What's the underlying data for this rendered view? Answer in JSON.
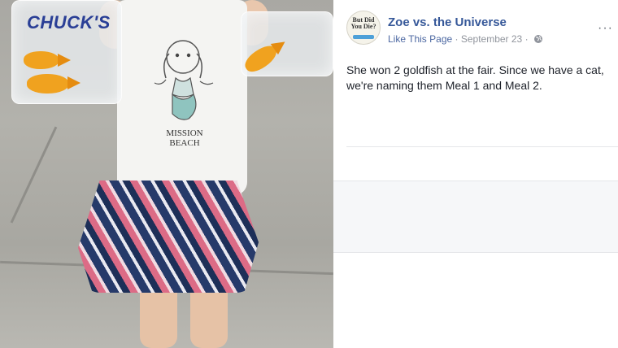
{
  "photo": {
    "bag_label": "CHUCK'S",
    "shirt_text": "MISSION BEACH"
  },
  "post": {
    "avatar_text": "But Did You Die?",
    "page_name": "Zoe vs. the Universe",
    "like_label": "Like This Page",
    "separator": " · ",
    "date": "September 23",
    "more_label": "···",
    "text": "She won 2 goldfish at the fair. Since we have a cat, we're naming them Meal 1 and Meal 2."
  },
  "colors": {
    "link": "#365899",
    "meta": "#90949c",
    "text": "#1d2129"
  }
}
